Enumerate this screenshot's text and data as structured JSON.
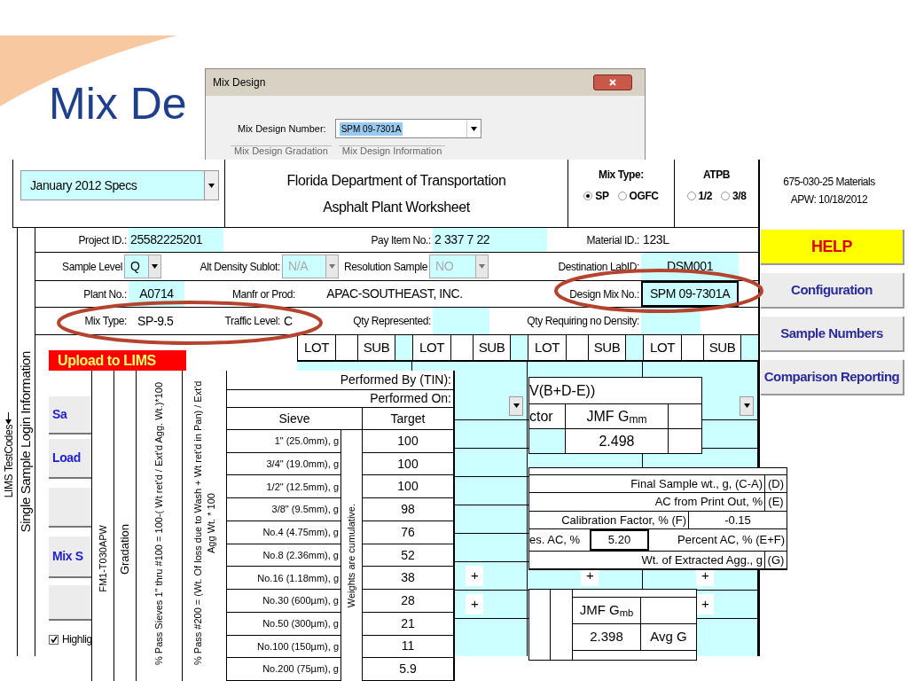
{
  "slide_title": "Mix De",
  "dialog": {
    "title": "Mix Design",
    "field_label": "Mix Design Number:",
    "field_value": "SPM 09-7301A",
    "groups": [
      "Mix Design Gradation",
      "Mix Design Information"
    ]
  },
  "worksheet": {
    "side_labels": [
      "LIMS TestCodes",
      "Single Sample Login Information"
    ],
    "spec_select": "January 2012 Specs",
    "title_lines": [
      "Florida Department of Transportation",
      "Asphalt Plant Worksheet"
    ],
    "mix_type": {
      "label": "Mix Type:",
      "options": [
        {
          "label": "SP",
          "selected": true
        },
        {
          "label": "OGFC",
          "selected": false
        }
      ]
    },
    "atpb": {
      "label": "ATPB",
      "options": [
        {
          "label": "1/2",
          "selected": false
        },
        {
          "label": "3/8",
          "selected": false
        }
      ]
    },
    "project_id": {
      "label": "Project ID.:",
      "value": "25582225201"
    },
    "pay_item": {
      "label": "Pay Item No.:",
      "value": "2 337  7 22"
    },
    "material_id": {
      "label": "Material ID.:",
      "value": "123L"
    },
    "sample_level": {
      "label": "Sample Level",
      "value": "Q",
      "disabled": false
    },
    "alt_density": {
      "label": "Alt Density Sublot:",
      "value": "N/A",
      "disabled": true
    },
    "resolution": {
      "label": "Resolution Sample",
      "value": "NO",
      "disabled": true
    },
    "destination": {
      "label": "Destination LabID:",
      "value": "DSM001"
    },
    "plant": {
      "label": "Plant No.:",
      "value": "A0714"
    },
    "manufacturer": {
      "label": "Manfr or Prod:",
      "value": "APAC-SOUTHEAST, INC."
    },
    "design_mix": {
      "label": "Design Mix No.:",
      "value": "SPM 09-7301A"
    },
    "mix_type_field": {
      "label": "Mix Type:",
      "value": "SP-9.5"
    },
    "traffic": {
      "label": "Traffic Level:",
      "value": "C"
    },
    "qty_represented": {
      "label": "Qty Represented:"
    },
    "qty_no_density": {
      "label": "Qty Requiring no Density:"
    },
    "lot_headers": [
      {
        "lot": "LOT",
        "sub": "SUB"
      },
      {
        "lot": "LOT",
        "sub": "SUB"
      },
      {
        "lot": "LOT",
        "sub": "SUB"
      },
      {
        "lot": "LOT",
        "sub": "SUB"
      }
    ],
    "left_buttons": [
      {
        "kind": "upload",
        "label": "Upload to LIMS"
      },
      {
        "kind": "normal",
        "label": "Sa"
      },
      {
        "kind": "normal",
        "label": "Load"
      },
      {
        "kind": "normal"
      },
      {
        "kind": "normal",
        "label": "Mix S"
      },
      {
        "kind": "normal"
      }
    ],
    "highlight": {
      "label": "Highlig",
      "checked": true
    },
    "lot_grid": {
      "column_2_marks": [
        "+",
        "+"
      ],
      "column_3_marks": [
        "+"
      ],
      "column_4_marks": [
        "+",
        "+"
      ]
    }
  },
  "form_code": [
    "675-030-25 Materials",
    "APW: 10/18/2012"
  ],
  "side_buttons": [
    {
      "kind": "help",
      "label": "HELP"
    },
    {
      "kind": "normal",
      "label": "Configuration"
    },
    {
      "kind": "normal",
      "label": "Sample Numbers"
    },
    {
      "kind": "normal",
      "label": "Comparison Reporting"
    }
  ],
  "gradation": {
    "code": "FM1-T030APW",
    "title": "Gradation",
    "formula_1": "% Pass Sieves 1\" thru #100 = 100-( Wt ret'd / Ext'd Agg. Wt.)*100",
    "formula_2": "% Pass #200 = (Wt. Of loss due to Wash + Wt ret'd in Pan) / Ext'd Agg Wt. * 100",
    "performed_by": "Performed By (TIN):",
    "performed_on": "Performed On:",
    "sieve_header": "Sieve",
    "target_header": "Target",
    "note": "Weights are cumulative.",
    "rows": [
      {
        "sieve": "1\" (25.0mm), g",
        "target": "100"
      },
      {
        "sieve": "3/4\" (19.0mm), g",
        "target": "100"
      },
      {
        "sieve": "1/2\" (12.5mm), g",
        "target": "100"
      },
      {
        "sieve": "3/8\" (9.5mm), g",
        "target": "98"
      },
      {
        "sieve": "No.4 (4.75mm), g",
        "target": "76"
      },
      {
        "sieve": "No.8 (2.36mm), g",
        "target": "52"
      },
      {
        "sieve": "No.16 (1.18mm), g",
        "target": "38"
      },
      {
        "sieve": "No.30 (600µm), g",
        "target": "28"
      },
      {
        "sieve": "No.50 (300µm), g",
        "target": "21"
      },
      {
        "sieve": "No.100 (150µm), g",
        "target": "11"
      },
      {
        "sieve": "No.200 (75µm), g",
        "target": "5.9"
      }
    ]
  },
  "gmm_panel": {
    "formula": "V(B+D-E))",
    "factor_label": "ctor",
    "header": "JMF G$_{mm}$",
    "value": "2.498"
  },
  "ac_panel": {
    "rows": [
      {
        "kind": "code",
        "label": "Final Sample wt., g, (C-A)",
        "code": "(D)"
      },
      {
        "kind": "code",
        "label": "AC from Print Out, %",
        "code": "(E)"
      },
      {
        "kind": "value",
        "label": "Calibration Factor, % (F)",
        "value": "-0.15"
      },
      {
        "kind": "split",
        "label": "es. AC, %",
        "value": "5.20",
        "label_2": "Percent AC, % (E+F)"
      },
      {
        "kind": "code",
        "label": "Wt. of Extracted Agg., g",
        "code": "(G)"
      }
    ]
  },
  "gmb_panel": {
    "header": "JMF G$_{mb}$",
    "value": "2.398",
    "avg_label": "Avg G"
  }
}
